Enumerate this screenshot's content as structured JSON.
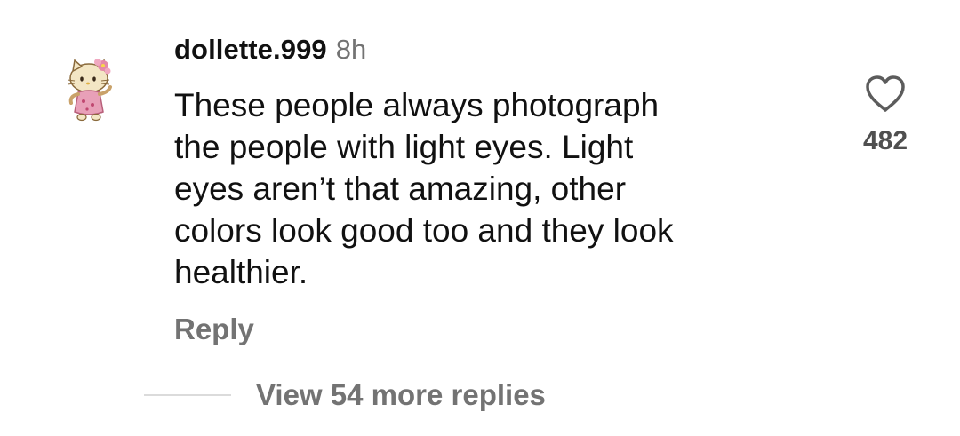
{
  "comment": {
    "avatar_icon": "hello-kitty-avatar-icon",
    "username": "dollette.999",
    "timestamp": "8h",
    "text": "These people always photograph\nthe people with light eyes. Light\neyes aren’t that amazing, other\ncolors look good too and they look\nhealthier.",
    "reply_label": "Reply",
    "like_icon": "heart-outline-icon",
    "like_count": "482"
  },
  "replies": {
    "view_more_label": "View 54 more replies"
  },
  "colors": {
    "text_primary": "#111111",
    "text_secondary": "#737373",
    "divider": "#dbdbdb",
    "background": "#ffffff"
  }
}
